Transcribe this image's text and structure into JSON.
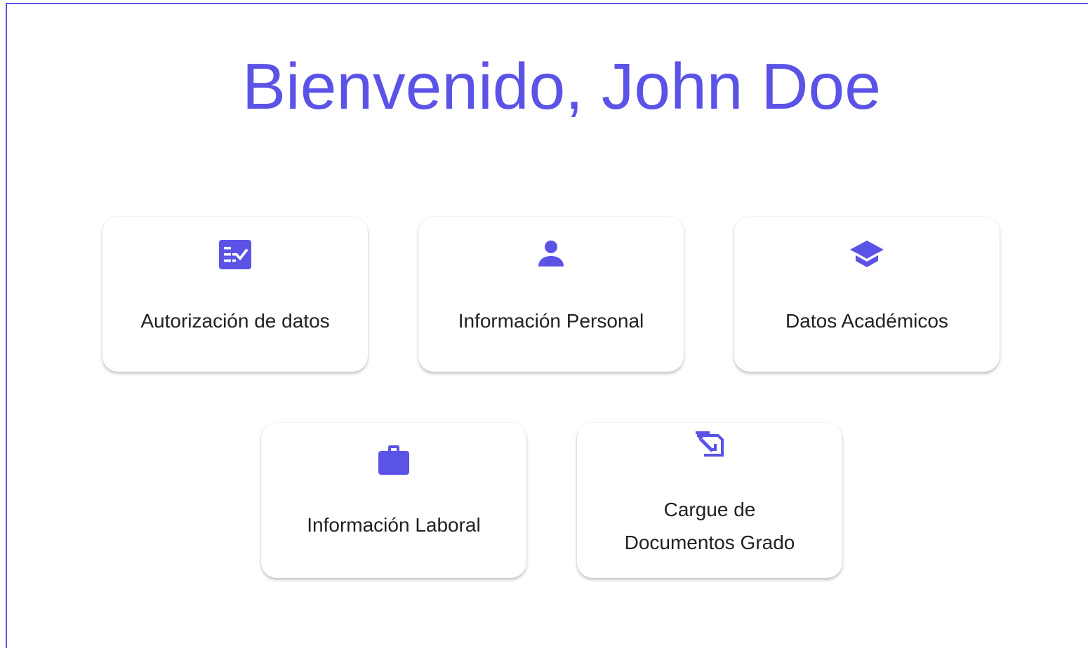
{
  "header": {
    "title": "Bienvenido, John Doe"
  },
  "colors": {
    "accent": "#5b53e6",
    "text": "#202124",
    "card_background": "#ffffff"
  },
  "cards": [
    {
      "label": "Autorización de datos",
      "icon": "checklist-icon"
    },
    {
      "label": "Información Personal",
      "icon": "person-icon"
    },
    {
      "label": "Datos Académicos",
      "icon": "graduation-cap-icon"
    },
    {
      "label": "Información Laboral",
      "icon": "briefcase-icon"
    },
    {
      "label_lines": [
        "Cargue de",
        "Documentos Grado"
      ],
      "icon": "document-upload-icon"
    }
  ]
}
